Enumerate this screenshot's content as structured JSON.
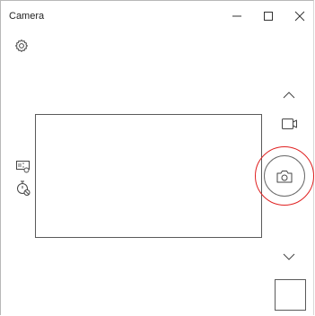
{
  "window": {
    "title": "Camera",
    "controls": [
      "minimize",
      "maximize",
      "close"
    ]
  },
  "icons": {
    "settings": "gear-icon",
    "photo_timer": "timer-icon",
    "hdr": "hdr-icon",
    "scroll_up": "chevron-up-icon",
    "video_mode": "video-camera-icon",
    "take_photo": "camera-icon",
    "scroll_down": "chevron-down-icon"
  },
  "colors": {
    "focus_ring": "#e02020",
    "icon_stroke": "#444444"
  }
}
